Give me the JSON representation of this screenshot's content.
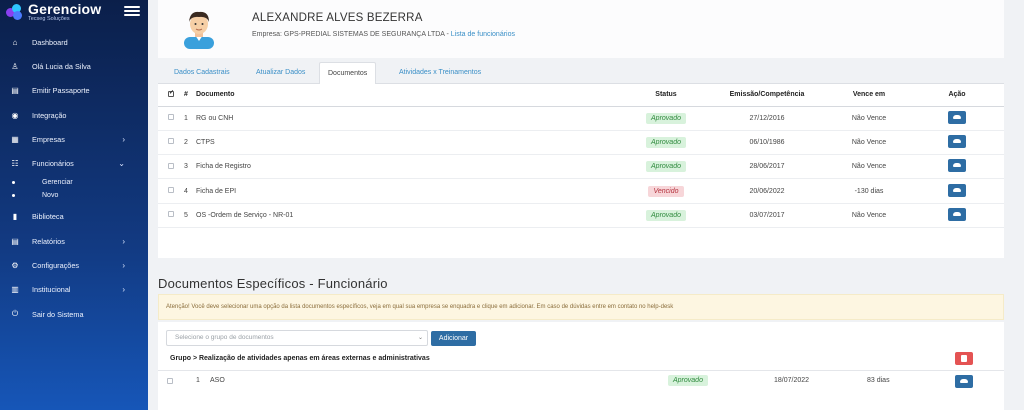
{
  "app": {
    "brand": "Gerenciow",
    "brand_sub": "Tecseg Soluções"
  },
  "sidebar": {
    "items": [
      {
        "label": "Dashboard",
        "icon": "home-icon",
        "glyph": "⌂"
      },
      {
        "label": "Olá Lucia da Silva",
        "icon": "user-icon",
        "glyph": "♙"
      },
      {
        "label": "Emitir Passaporte",
        "icon": "file-icon",
        "glyph": "▤"
      },
      {
        "label": "Integração",
        "icon": "eye-icon",
        "glyph": "◉"
      },
      {
        "label": "Empresas",
        "icon": "briefcase-icon",
        "glyph": "▦",
        "chevron": "›"
      },
      {
        "label": "Funcionários",
        "icon": "users-icon",
        "glyph": "☷",
        "chevron": "⌄"
      },
      {
        "label": "Biblioteca",
        "icon": "book-icon",
        "glyph": "▮"
      },
      {
        "label": "Relatórios",
        "icon": "report-icon",
        "glyph": "▤",
        "chevron": "›"
      },
      {
        "label": "Configurações",
        "icon": "gears-icon",
        "glyph": "⚙",
        "chevron": "›"
      },
      {
        "label": "Institucional",
        "icon": "building-icon",
        "glyph": "▥",
        "chevron": "›"
      },
      {
        "label": "Sair do Sistema",
        "icon": "power-icon",
        "glyph": "⏻"
      }
    ],
    "subitems": [
      "Gerenciar",
      "Novo"
    ]
  },
  "profile": {
    "name": "ALEXANDRE ALVES BEZERRA",
    "company_label": "Empresa: GPS-PREDIAL SISTEMAS DE SEGURANÇA LTDA - ",
    "list_link": "Lista de funcionários"
  },
  "tabs": [
    "Dados Cadastrais",
    "Atualizar Dados",
    "Documentos",
    "Atividades x Treinamentos"
  ],
  "active_tab": "Documentos",
  "documents": {
    "headers": {
      "num": "#",
      "doc": "Documento",
      "status": "Status",
      "emission": "Emissão/Competência",
      "expires": "Vence em",
      "action": "Ação"
    },
    "rows": [
      {
        "num": "1",
        "doc": "RG ou CNH",
        "status": "Aprovado",
        "emission": "27/12/2016",
        "expires": "Não Vence"
      },
      {
        "num": "2",
        "doc": "CTPS",
        "status": "Aprovado",
        "emission": "06/10/1986",
        "expires": "Não Vence"
      },
      {
        "num": "3",
        "doc": "Ficha de Registro",
        "status": "Aprovado",
        "emission": "28/06/2017",
        "expires": "Não Vence"
      },
      {
        "num": "4",
        "doc": "Ficha de EPI",
        "status": "Vencido",
        "emission": "20/06/2022",
        "expires": "-130 dias"
      },
      {
        "num": "5",
        "doc": "OS -Ordem de Serviço - NR-01",
        "status": "Aprovado",
        "emission": "03/07/2017",
        "expires": "Não Vence"
      }
    ]
  },
  "specific": {
    "title": "Documentos Específicos - Funcionário",
    "alert": "Atenção! Você deve selecionar uma opção da lista documentos específicos, veja em qual sua empresa se enquadra e clique em adicionar. Em caso de dúvidas entre em contato no help-desk",
    "select_placeholder": "Selecione o grupo de documentos",
    "add_label": "Adicionar",
    "group_label": "Grupo > Realização de atividades apenas em áreas externas e administrativas",
    "row": {
      "num": "1",
      "doc": "ASO",
      "status": "Aprovado",
      "emission": "18/07/2022",
      "expires": "83 dias"
    }
  },
  "colors": {
    "primary": "#2e6da4",
    "danger": "#e45353",
    "approved_bg": "#d8f2dc",
    "expired_bg": "#f7d6d9"
  }
}
